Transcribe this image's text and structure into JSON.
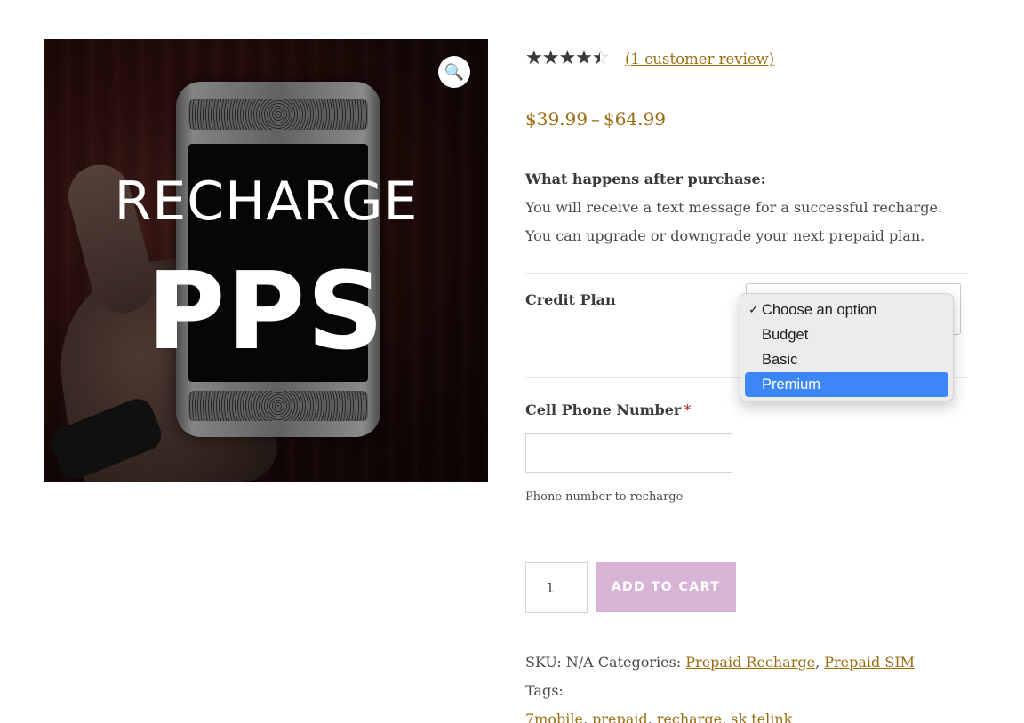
{
  "image": {
    "alt_line1": "RECHARGE",
    "alt_line2": "PPS",
    "zoom_icon": "magnifier-icon"
  },
  "rating": {
    "value": 4,
    "max": 5,
    "stars_full": "★★★★★",
    "stars_empty": "☆☆☆☆☆",
    "review_link": "(1 customer review)"
  },
  "price": {
    "min": "$39.99",
    "separator": "–",
    "max": "$64.99"
  },
  "description": {
    "heading": "What happens after purchase:",
    "line1": "You will receive a text message for a successful recharge.",
    "line2": "You can upgrade or downgrade your next prepaid plan."
  },
  "variation": {
    "label": "Credit Plan",
    "selected": "Choose an option",
    "options": [
      "Choose an option",
      "Budget",
      "Basic",
      "Premium"
    ],
    "highlighted": "Premium"
  },
  "phone_field": {
    "label": "Cell Phone Number",
    "required_mark": "*",
    "value": "",
    "help": "Phone number to recharge"
  },
  "cart": {
    "quantity": "1",
    "button_label": "ADD TO CART",
    "button_color": "#d7b3d6"
  },
  "meta": {
    "sku_label": "SKU:",
    "sku_value": "N/A",
    "categories_label": "Categories:",
    "categories": [
      "Prepaid Recharge",
      "Prepaid SIM"
    ],
    "tags_label": "Tags:",
    "tags": [
      "7mobile",
      "prepaid",
      "recharge",
      "sk telink"
    ]
  },
  "colors": {
    "link": "#9a6d12",
    "dropdown_highlight": "#3d86f7"
  }
}
